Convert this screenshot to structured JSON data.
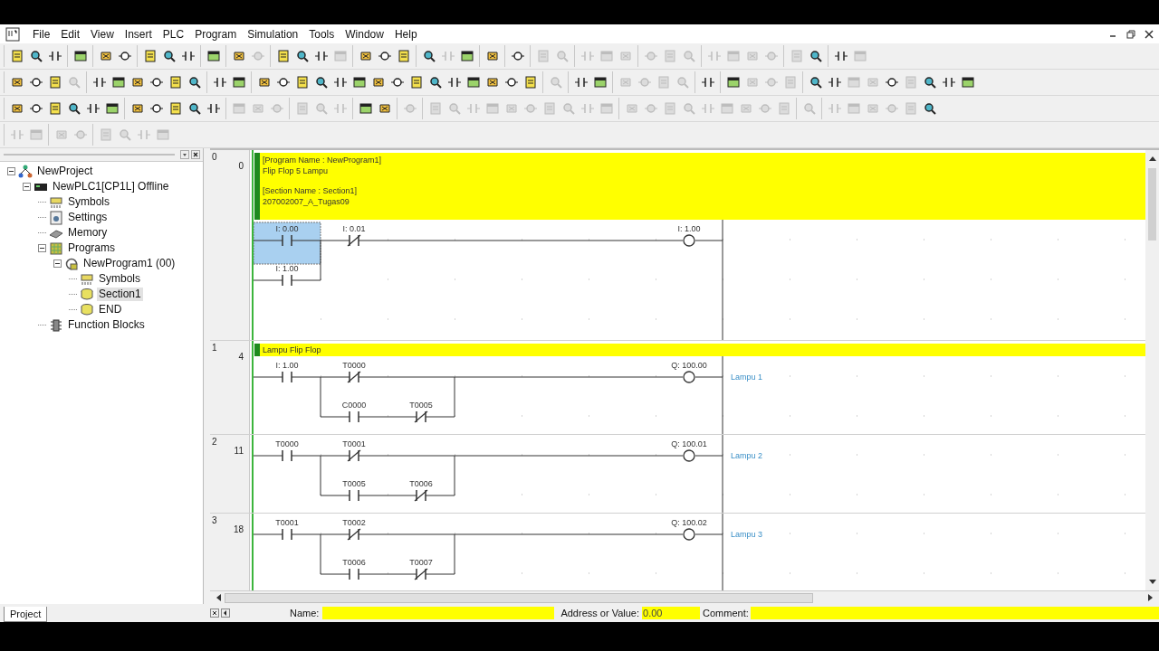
{
  "menu": [
    "File",
    "Edit",
    "View",
    "Insert",
    "PLC",
    "Program",
    "Simulation",
    "Tools",
    "Window",
    "Help"
  ],
  "toolbars": [
    [
      [
        {
          "disabled": false
        },
        {
          "disabled": false
        },
        {
          "disabled": false
        }
      ],
      [
        {
          "disabled": false
        }
      ],
      [
        {
          "disabled": false
        },
        {
          "disabled": false
        }
      ],
      [
        {
          "disabled": false
        },
        {
          "disabled": false
        },
        {
          "disabled": false
        }
      ],
      [
        {
          "disabled": false
        }
      ],
      [
        {
          "disabled": false
        },
        {
          "disabled": true
        }
      ],
      [
        {
          "disabled": false
        },
        {
          "disabled": false
        },
        {
          "disabled": false
        },
        {
          "disabled": true
        }
      ],
      [
        {
          "disabled": false
        },
        {
          "disabled": false
        },
        {
          "disabled": false
        }
      ],
      [
        {
          "disabled": false
        },
        {
          "disabled": true
        },
        {
          "disabled": false
        }
      ],
      [
        {
          "disabled": false
        }
      ],
      [
        {
          "disabled": false
        }
      ],
      [
        {
          "disabled": true
        },
        {
          "disabled": true
        }
      ],
      [
        {
          "disabled": true
        },
        {
          "disabled": true
        },
        {
          "disabled": true
        }
      ],
      [
        {
          "disabled": true
        },
        {
          "disabled": true
        },
        {
          "disabled": true
        }
      ],
      [
        {
          "disabled": true
        },
        {
          "disabled": true
        },
        {
          "disabled": true
        },
        {
          "disabled": true
        }
      ],
      [
        {
          "disabled": true
        },
        {
          "disabled": false
        }
      ],
      [
        {
          "disabled": false
        },
        {
          "disabled": true
        }
      ]
    ],
    [
      [
        {
          "disabled": false
        },
        {
          "disabled": false
        },
        {
          "disabled": false
        },
        {
          "disabled": true
        }
      ],
      [
        {
          "disabled": false
        },
        {
          "disabled": false
        },
        {
          "disabled": false
        },
        {
          "disabled": false
        },
        {
          "disabled": false
        },
        {
          "disabled": false
        }
      ],
      [
        {
          "disabled": false
        },
        {
          "disabled": false
        }
      ],
      [
        {
          "disabled": false
        },
        {
          "disabled": false
        },
        {
          "disabled": false
        },
        {
          "disabled": false
        },
        {
          "disabled": false
        },
        {
          "disabled": false
        },
        {
          "disabled": false
        },
        {
          "disabled": false
        },
        {
          "disabled": false
        },
        {
          "disabled": false
        },
        {
          "disabled": false
        },
        {
          "disabled": false
        },
        {
          "disabled": false
        },
        {
          "disabled": false
        },
        {
          "disabled": false
        }
      ],
      [
        {
          "disabled": true
        }
      ],
      [
        {
          "disabled": false
        },
        {
          "disabled": false
        }
      ],
      [
        {
          "disabled": true
        },
        {
          "disabled": true
        },
        {
          "disabled": true
        },
        {
          "disabled": true
        }
      ],
      [
        {
          "disabled": false
        }
      ],
      [
        {
          "disabled": false
        },
        {
          "disabled": true
        },
        {
          "disabled": true
        },
        {
          "disabled": true
        }
      ],
      [
        {
          "disabled": false
        },
        {
          "disabled": false
        },
        {
          "disabled": true
        },
        {
          "disabled": true
        },
        {
          "disabled": false
        },
        {
          "disabled": true
        },
        {
          "disabled": false
        },
        {
          "disabled": false
        },
        {
          "disabled": false
        }
      ]
    ],
    [
      [
        {
          "disabled": false
        },
        {
          "disabled": false
        },
        {
          "disabled": false
        },
        {
          "disabled": false
        },
        {
          "disabled": false
        },
        {
          "disabled": false
        }
      ],
      [
        {
          "disabled": false
        },
        {
          "disabled": false
        },
        {
          "disabled": false
        },
        {
          "disabled": false
        },
        {
          "disabled": false
        }
      ],
      [
        {
          "disabled": true
        },
        {
          "disabled": true
        },
        {
          "disabled": true
        }
      ],
      [
        {
          "disabled": true
        },
        {
          "disabled": true
        },
        {
          "disabled": true
        }
      ],
      [
        {
          "disabled": false
        },
        {
          "disabled": false
        }
      ],
      [
        {
          "disabled": true
        }
      ],
      [
        {
          "disabled": true
        },
        {
          "disabled": true
        },
        {
          "disabled": true
        },
        {
          "disabled": true
        },
        {
          "disabled": true
        },
        {
          "disabled": true
        },
        {
          "disabled": true
        },
        {
          "disabled": true
        },
        {
          "disabled": true
        },
        {
          "disabled": true
        }
      ],
      [
        {
          "disabled": true
        },
        {
          "disabled": true
        },
        {
          "disabled": true
        },
        {
          "disabled": true
        },
        {
          "disabled": true
        },
        {
          "disabled": true
        },
        {
          "disabled": true
        },
        {
          "disabled": true
        },
        {
          "disabled": true
        }
      ],
      [
        {
          "disabled": true
        }
      ],
      [
        {
          "disabled": true
        },
        {
          "disabled": true
        },
        {
          "disabled": true
        },
        {
          "disabled": true
        },
        {
          "disabled": true
        },
        {
          "disabled": false
        }
      ]
    ],
    [
      [
        {
          "disabled": true
        },
        {
          "disabled": true
        }
      ],
      [
        {
          "disabled": true
        },
        {
          "disabled": true
        }
      ],
      [
        {
          "disabled": true
        },
        {
          "disabled": true
        },
        {
          "disabled": true
        },
        {
          "disabled": true
        }
      ]
    ]
  ],
  "project_tree": {
    "tab": "Project",
    "items": [
      {
        "label": "NewProject",
        "kind": "project",
        "expanded": true,
        "selected": false,
        "children": [
          {
            "label": "NewPLC1[CP1L] Offline",
            "kind": "plc",
            "expanded": true,
            "selected": false,
            "children": [
              {
                "label": "Symbols",
                "kind": "symbols",
                "selected": false
              },
              {
                "label": "Settings",
                "kind": "settings",
                "selected": false
              },
              {
                "label": "Memory",
                "kind": "memory",
                "selected": false
              },
              {
                "label": "Programs",
                "kind": "programs",
                "expanded": true,
                "selected": false,
                "children": [
                  {
                    "label": "NewProgram1 (00)",
                    "kind": "program",
                    "expanded": true,
                    "selected": false,
                    "children": [
                      {
                        "label": "Symbols",
                        "kind": "symbols",
                        "selected": false
                      },
                      {
                        "label": "Section1",
                        "kind": "section",
                        "selected": true
                      },
                      {
                        "label": "END",
                        "kind": "section",
                        "selected": false
                      }
                    ]
                  }
                ]
              },
              {
                "label": "Function Blocks",
                "kind": "function_blocks",
                "selected": false
              }
            ]
          }
        ]
      }
    ]
  },
  "ladder": {
    "rungs": [
      {
        "number": "0",
        "step": "0",
        "comment_blocks": [
          [
            "[Program Name : NewProgram1]",
            "Flip Flop 5 Lampu"
          ],
          [
            "[Section Name : Section1]",
            "207002007_A_Tugas09"
          ]
        ],
        "contacts": [
          {
            "kind": "no",
            "label": "I: 0.00",
            "selected": true,
            "parallel": [
              {
                "kind": "no",
                "label": "I: 1.00",
                "selected": false
              }
            ]
          },
          {
            "kind": "nc",
            "label": "I: 0.01",
            "selected": false
          }
        ],
        "coil": {
          "label": "I: 1.00"
        }
      },
      {
        "number": "1",
        "step": "4",
        "comment_blocks": [
          [
            "Lampu Flip Flop"
          ]
        ],
        "contacts": [
          {
            "kind": "no",
            "label": "I: 1.00",
            "selected": false
          },
          {
            "kind": "nc",
            "label": "T0000",
            "selected": false,
            "parallel": [
              {
                "kind": "no",
                "label": "C0000",
                "selected": false
              },
              {
                "kind": "nc",
                "label": "T0005",
                "selected": false
              }
            ]
          }
        ],
        "coil": {
          "label": "Q: 100.00",
          "symbol": "Lampu 1"
        }
      },
      {
        "number": "2",
        "step": "11",
        "contacts": [
          {
            "kind": "no",
            "label": "T0000",
            "selected": false
          },
          {
            "kind": "nc",
            "label": "T0001",
            "selected": false,
            "parallel": [
              {
                "kind": "no",
                "label": "T0005",
                "selected": false
              },
              {
                "kind": "nc",
                "label": "T0006",
                "selected": false
              }
            ]
          }
        ],
        "coil": {
          "label": "Q: 100.01",
          "symbol": "Lampu 2"
        }
      },
      {
        "number": "3",
        "step": "18",
        "contacts": [
          {
            "kind": "no",
            "label": "T0001",
            "selected": false
          },
          {
            "kind": "nc",
            "label": "T0002",
            "selected": false,
            "parallel": [
              {
                "kind": "no",
                "label": "T0006",
                "selected": false
              },
              {
                "kind": "nc",
                "label": "T0007",
                "selected": false
              }
            ]
          }
        ],
        "coil": {
          "label": "Q: 100.02",
          "symbol": "Lampu 3"
        }
      }
    ]
  },
  "status_fields": {
    "name_label": "Name:",
    "address_label": "Address or Value:",
    "address_value": "0.00",
    "comment_label": "Comment:"
  }
}
